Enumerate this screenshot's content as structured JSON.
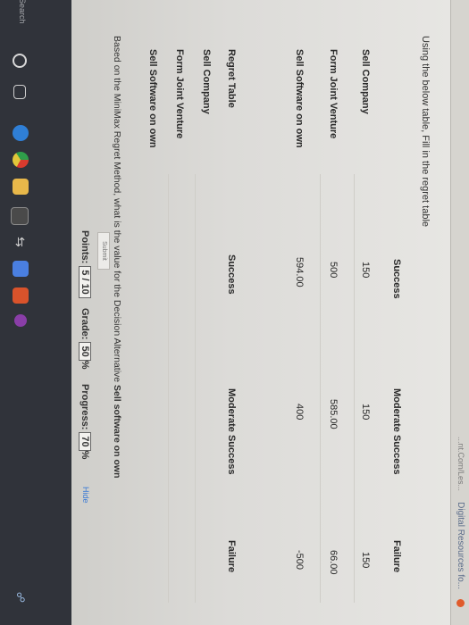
{
  "top_bar": {
    "link_text": "Digital Resources fo...",
    "link_text2": "...nt.Com/Les..."
  },
  "instruction": "Using the below table, Fill in the regret table",
  "payoff_table": {
    "headers": [
      "Success",
      "Moderate Success",
      "Failure"
    ],
    "rows": [
      {
        "label": "Sell Company",
        "cells": [
          "150",
          "150",
          "150"
        ]
      },
      {
        "label": "Form Joint Venture",
        "cells": [
          "500",
          "585.00",
          "66.00"
        ]
      },
      {
        "label": "Sell Software on own",
        "cells": [
          "594.00",
          "400",
          "-500"
        ]
      }
    ]
  },
  "regret_table": {
    "title": "Regret Table",
    "headers": [
      "Success",
      "Moderate Success",
      "Failure"
    ],
    "rows": [
      "Sell Company",
      "Form Joint Venture",
      "Sell Software on own"
    ]
  },
  "question": {
    "prefix": "Based on the MiniMax Regret Method, what is the value for the Decision Alternative ",
    "bold": "Sell software on own"
  },
  "submit_label": "Submit",
  "status": {
    "points_label": "Points:",
    "points_value": "5 / 10",
    "grade_label": "Grade:",
    "grade_value": "50",
    "grade_suffix": "%",
    "progress_label": "Progress:",
    "progress_value": "70",
    "progress_suffix": "%",
    "hide_label": "Hide"
  },
  "taskbar": {
    "search_label": "Search",
    "icons": [
      "task-view-icon",
      "edge-icon",
      "chrome-icon",
      "file-explorer-icon",
      "store-icon",
      "dropbox-icon",
      "photos-icon",
      "office-icon",
      "onenote-icon"
    ],
    "colors": {
      "edge": "#2f7fd6",
      "chrome": "#e2c73a",
      "explorer": "#e8b84a",
      "store": "#4a4a4a",
      "dropbox": "#2b6fd8",
      "photos": "#4a7fe0",
      "office": "#d9532b",
      "onenote": "#8a3ea8"
    }
  },
  "accent_color": "#3c7bd5"
}
